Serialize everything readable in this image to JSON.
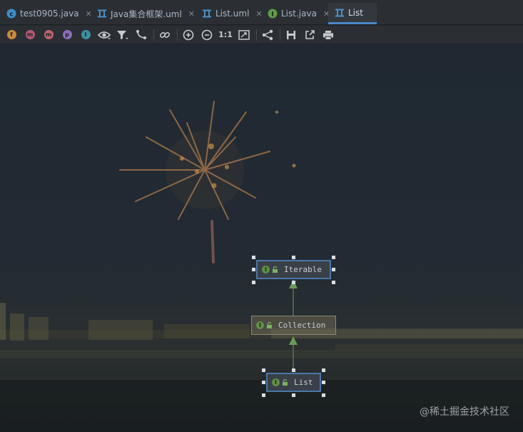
{
  "tabs": [
    {
      "label": "test0905.java",
      "icon": "java-class-icon",
      "active": false
    },
    {
      "label": "Java集合框架.uml",
      "icon": "uml-diagram-icon",
      "active": false
    },
    {
      "label": "List.uml",
      "icon": "uml-diagram-icon",
      "active": false
    },
    {
      "label": "List.java",
      "icon": "interface-icon",
      "active": false
    },
    {
      "label": "List",
      "icon": "uml-diagram-icon",
      "active": true
    }
  ],
  "toolbar": {
    "filters": [
      {
        "letter": "f",
        "name": "fields",
        "color": "#c98a3d"
      },
      {
        "letter": "m",
        "name": "constructors",
        "color": "#b35a75"
      },
      {
        "letter": "m",
        "name": "methods",
        "color": "#c0626c"
      },
      {
        "letter": "p",
        "name": "properties",
        "color": "#8e6fbf"
      },
      {
        "letter": "I",
        "name": "inner-classes",
        "color": "#3f8fa3"
      }
    ],
    "actual_size_label": "1:1"
  },
  "diagram": {
    "nodes": [
      {
        "id": "iterable",
        "label": "Iterable",
        "kind": "I",
        "selected": true
      },
      {
        "id": "collection",
        "label": "Collection",
        "kind": "I",
        "selected": false
      },
      {
        "id": "list",
        "label": "List",
        "kind": "I",
        "selected": true
      }
    ],
    "edge_color": "#6a9a5a"
  },
  "watermark": "@稀土掘金技术社区"
}
